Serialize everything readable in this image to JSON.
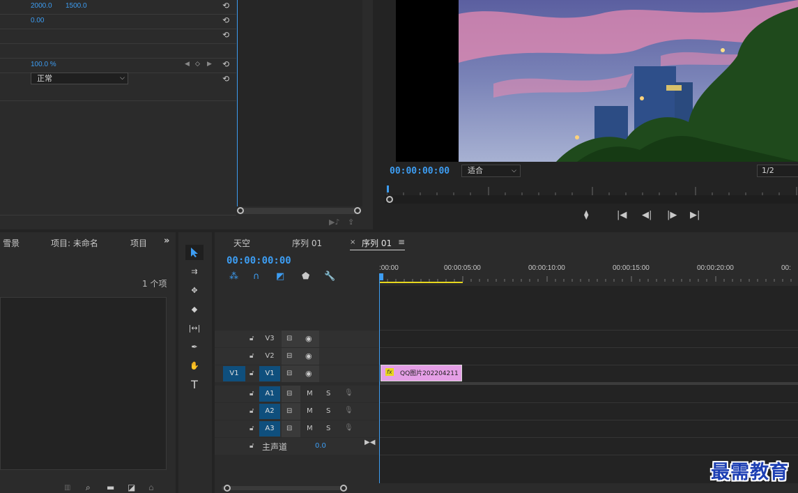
{
  "effects": {
    "rows": [
      {
        "value": "2000.0",
        "value2": "1500.0"
      },
      {
        "value": "0.00"
      },
      {
        "value": ""
      },
      {
        "value": ""
      },
      {
        "value": "100.0 %"
      },
      {
        "value": ""
      }
    ],
    "blend_mode": "正常"
  },
  "monitor": {
    "timecode": "00:00:00:00",
    "fit": "适合",
    "resolution": "1/2"
  },
  "project": {
    "tabs": [
      "雪景",
      "项目: 未命名",
      "项目"
    ],
    "item_count": "1 个项"
  },
  "timeline": {
    "tabs": {
      "tab1": "天空",
      "tab2": "序列 01",
      "active": "序列 01"
    },
    "timecode": "00:00:00:00",
    "ruler": [
      ":00:00",
      "00:00:05:00",
      "00:00:10:00",
      "00:00:15:00",
      "00:00:20:00",
      "00:"
    ],
    "video_tracks": [
      "V3",
      "V2",
      "V1"
    ],
    "source_track": "V1",
    "audio_tracks": [
      "A1",
      "A2",
      "A3"
    ],
    "audio_buttons": {
      "mute": "M",
      "solo": "S"
    },
    "master": {
      "label": "主声道",
      "value": "0.0"
    },
    "clip": {
      "fx": "fx",
      "name": "QQ图片202204211"
    }
  },
  "watermark": "最需教育",
  "colors": {
    "accent": "#3d9df2",
    "clip": "#e59fe6",
    "track_on": "#0f4f7d"
  }
}
